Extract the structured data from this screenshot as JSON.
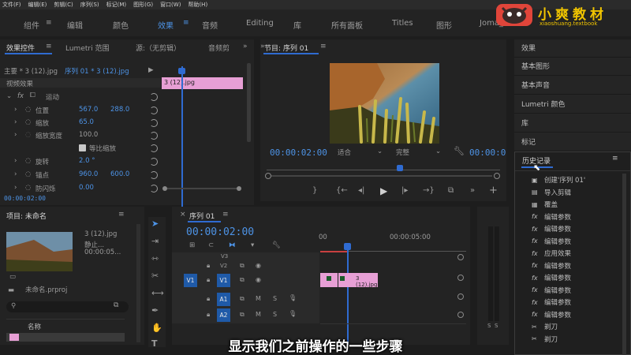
{
  "menubar": [
    "文件(F)",
    "编辑(E)",
    "剪辑(C)",
    "序列(S)",
    "标记(M)",
    "图形(G)",
    "窗口(W)",
    "帮助(H)"
  ],
  "workspaces": {
    "items": [
      "组件",
      "编辑",
      "颜色",
      "效果",
      "音频",
      "Editing",
      "库",
      "所有面板",
      "Titles",
      "图形",
      "Joma_U"
    ],
    "active": "效果"
  },
  "logo": {
    "title": "小爽教材",
    "subtitle": "xiaoshuang.textbook"
  },
  "effect_controls": {
    "tabs": [
      "效果控件",
      "Lumetri 范围",
      "源:（无剪辑）",
      "音频剪"
    ],
    "master_label": "主要 * 3 (12).jpg",
    "sequence_label": "序列 01 * 3 (12).jpg",
    "clip_label": "3 (12).jpg",
    "section_video": "视频效果",
    "fx_motion": "运动",
    "props": [
      {
        "name": "位置",
        "v1": "567.0",
        "v2": "288.0"
      },
      {
        "name": "缩放",
        "v1": "65.0",
        "v2": ""
      },
      {
        "name": "缩放宽度",
        "v1": "100.0",
        "v2": ""
      },
      {
        "name": "旋转",
        "v1": "2.0 °",
        "v2": ""
      },
      {
        "name": "锚点",
        "v1": "960.0",
        "v2": "600.0"
      },
      {
        "name": "防闪烁",
        "v1": "0.00",
        "v2": ""
      }
    ],
    "uniform_scale": "等比缩放",
    "timecode": "00:00:02:00"
  },
  "program": {
    "title": "节目: 序列 01",
    "timecode": "00:00:02:00",
    "fit": "适合",
    "quality": "完整",
    "timecode_right": "00:00:0"
  },
  "project": {
    "title": "项目: 未命名",
    "clip_name": "3 (12).jpg",
    "clip_kind": "静止...",
    "clip_dur": "00:00:05...",
    "file": "未命名.prproj",
    "col_name": "名称"
  },
  "timeline": {
    "title": "序列 01",
    "timecode": "00:00:02:00",
    "ruler": [
      "00",
      "00:00:05:00"
    ],
    "tracks": [
      "V3",
      "V2",
      "V1",
      "A1",
      "A2"
    ],
    "clip": "3 (12).jpg"
  },
  "right_panel": {
    "items": [
      "效果",
      "基本图形",
      "基本声音",
      "Lumetri 颜色",
      "库",
      "标记"
    ],
    "history_title": "历史记录",
    "history": [
      {
        "icon": "seq",
        "text": "创建'序列 01'"
      },
      {
        "icon": "import",
        "text": "导入剪辑"
      },
      {
        "icon": "overlay",
        "text": "覆盖"
      },
      {
        "icon": "fx",
        "text": "编辑参数"
      },
      {
        "icon": "fx",
        "text": "编辑参数"
      },
      {
        "icon": "fx",
        "text": "编辑参数"
      },
      {
        "icon": "fx",
        "text": "应用效果"
      },
      {
        "icon": "fx",
        "text": "编辑参数"
      },
      {
        "icon": "fx",
        "text": "编辑参数"
      },
      {
        "icon": "fx",
        "text": "编辑参数"
      },
      {
        "icon": "fx",
        "text": "编辑参数"
      },
      {
        "icon": "fx",
        "text": "编辑参数"
      },
      {
        "icon": "razor",
        "text": "剃刀"
      },
      {
        "icon": "razor",
        "text": "剃刀"
      }
    ]
  },
  "audio_meter": {
    "labels": [
      "S",
      "S"
    ]
  },
  "subtitle": "显示我们之前操作的一些步骤"
}
